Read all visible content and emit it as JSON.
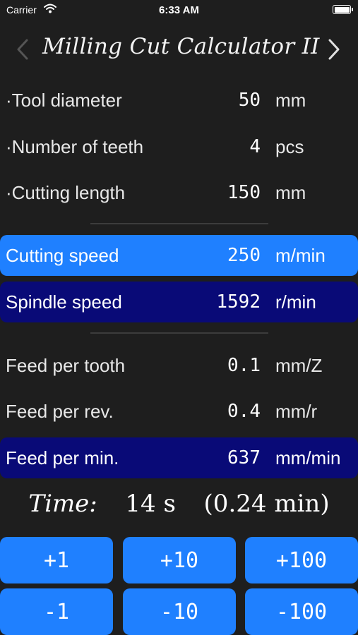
{
  "status_bar": {
    "carrier": "Carrier",
    "time": "6:33 AM"
  },
  "nav": {
    "title": "Milling Cut Calculator II"
  },
  "inputs": [
    {
      "label": "·Tool diameter",
      "value": "50",
      "unit": "mm"
    },
    {
      "label": "·Number of teeth",
      "value": "4",
      "unit": "pcs"
    },
    {
      "label": "·Cutting length",
      "value": "150",
      "unit": "mm"
    }
  ],
  "speeds": [
    {
      "label": "Cutting speed",
      "value": "250",
      "unit": "m/min"
    },
    {
      "label": "Spindle speed",
      "value": "1592",
      "unit": "r/min"
    }
  ],
  "feeds": [
    {
      "label": "Feed per tooth",
      "value": "0.1",
      "unit": "mm/Z"
    },
    {
      "label": "Feed per rev.",
      "value": "0.4",
      "unit": "mm/r"
    },
    {
      "label": "Feed per min.",
      "value": "637",
      "unit": "mm/min"
    }
  ],
  "time": {
    "label": "Time:",
    "seconds": "14 s",
    "minutes": "(0.24 min)"
  },
  "buttons": {
    "plus_1": "+1",
    "plus_10": "+10",
    "plus_100": "+100",
    "minus_1": "-1",
    "minus_10": "-10",
    "minus_100": "-100"
  },
  "colors": {
    "background": "#1e1e1e",
    "accent_light": "#1f80ff",
    "accent_dark": "#090a77"
  }
}
